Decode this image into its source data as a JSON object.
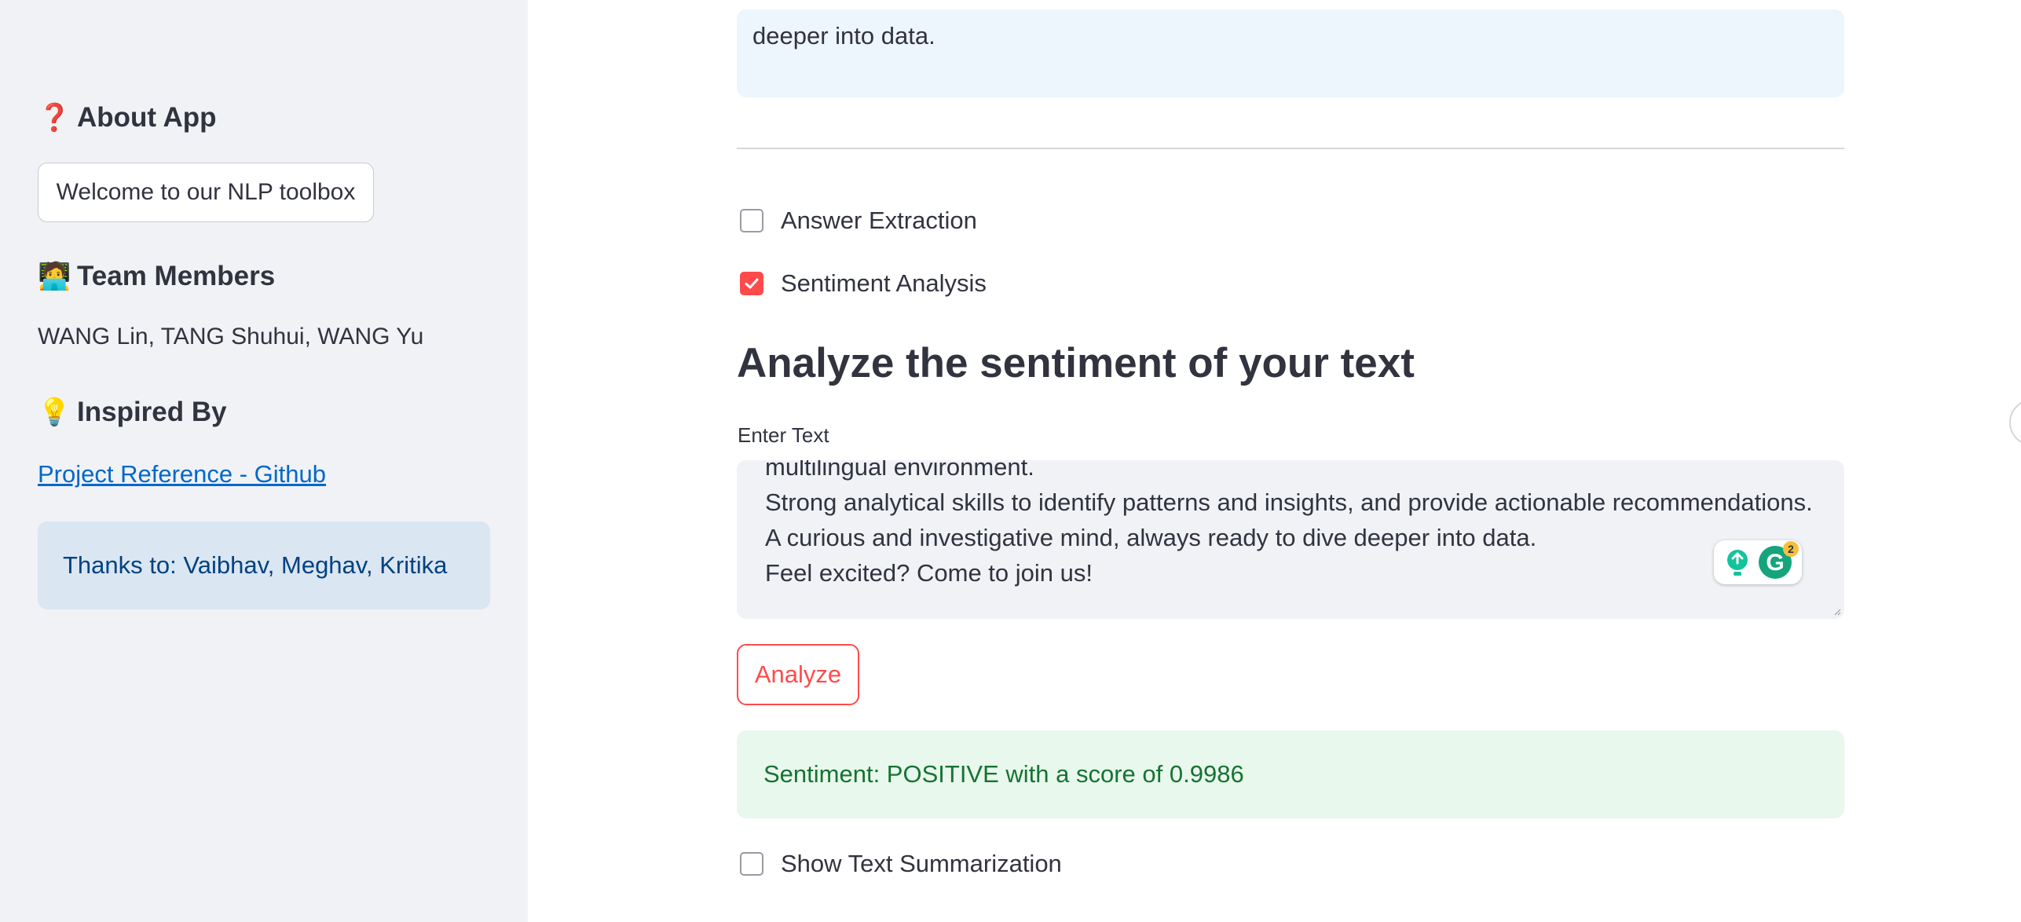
{
  "sidebar": {
    "about_heading": "About App",
    "about_emoji": "❓",
    "welcome_label": "Welcome to our NLP toolbox",
    "team_heading": "Team Members",
    "team_emoji": "🧑‍💻",
    "team_members": "WANG Lin, TANG Shuhui, WANG Yu",
    "inspired_heading": "Inspired By",
    "inspired_emoji": "💡",
    "project_link": "Project Reference - Github",
    "thanks": "Thanks to: Vaibhav, Meghav, Kritika"
  },
  "main": {
    "info_text": "deeper into data.",
    "answer_extraction": {
      "label": "Answer Extraction",
      "checked": false
    },
    "sentiment_analysis": {
      "label": "Sentiment Analysis",
      "checked": true
    },
    "title": "Analyze the sentiment of your text",
    "input_label": "Enter Text",
    "textarea_lines": [
      "multilingual environment.",
      "Strong analytical skills to identify patterns and insights, and provide actionable recommendations.",
      "A curious and investigative mind, always ready to dive deeper into data.",
      "Feel excited? Come to join us!"
    ],
    "grammarly_badge_count": "2",
    "analyze_button": "Analyze",
    "result_text": "Sentiment: POSITIVE with a score of 0.9986",
    "summarization": {
      "label": "Show Text Summarization",
      "checked": false
    }
  },
  "colors": {
    "accent": "#ff4b4b",
    "sidebar_bg": "#f0f2f6",
    "info_bg": "#edf5fd",
    "success_bg": "#e8f8ec",
    "success_text": "#177233",
    "link": "#0068c9"
  },
  "icons": {
    "about": "question-mark-icon",
    "team": "technologist-icon",
    "inspired": "light-bulb-icon",
    "checkmark": "checkmark-icon",
    "grammarly": "grammarly-icon"
  }
}
